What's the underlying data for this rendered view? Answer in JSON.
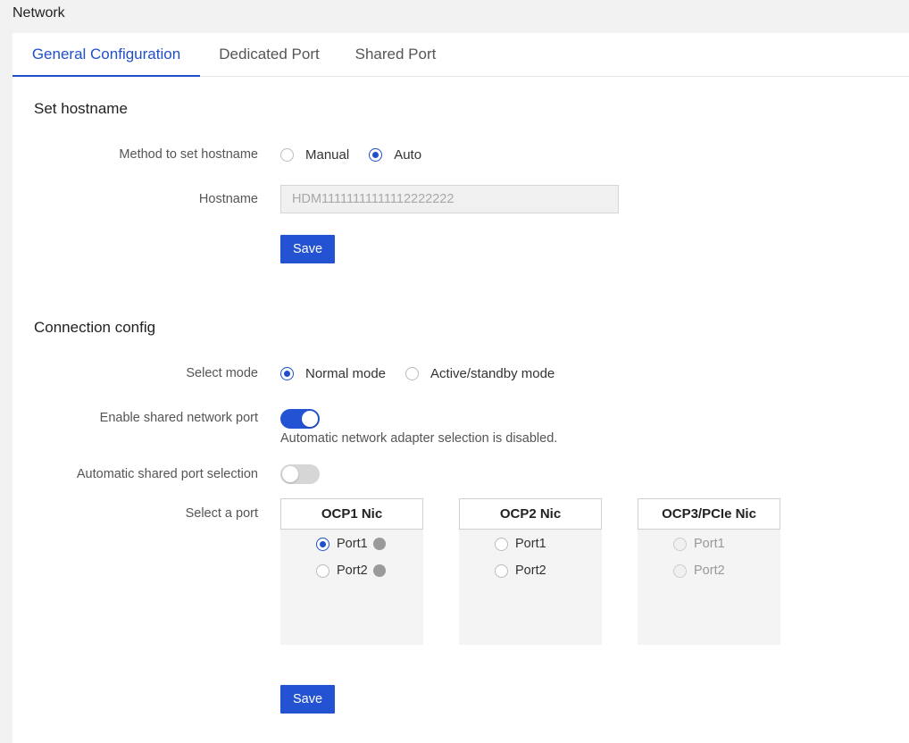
{
  "page": {
    "title": "Network"
  },
  "tabs": [
    {
      "label": "General Configuration",
      "active": true
    },
    {
      "label": "Dedicated Port",
      "active": false
    },
    {
      "label": "Shared Port",
      "active": false
    }
  ],
  "hostname_section": {
    "title": "Set hostname",
    "method_label": "Method to set hostname",
    "method_options": [
      "Manual",
      "Auto"
    ],
    "method_selected": "Auto",
    "hostname_label": "Hostname",
    "hostname_value": "HDM11111111111112222222",
    "save_label": "Save"
  },
  "connection_section": {
    "title": "Connection config",
    "mode_label": "Select mode",
    "mode_options": [
      "Normal mode",
      "Active/standby mode"
    ],
    "mode_selected": "Normal mode",
    "shared_port_label": "Enable shared network port",
    "shared_port_enabled": true,
    "shared_port_hint": "Automatic network adapter selection is disabled.",
    "auto_select_label": "Automatic shared port selection",
    "auto_select_enabled": false,
    "select_port_label": "Select a port",
    "nics": [
      {
        "name": "OCP1 Nic",
        "ports": [
          {
            "label": "Port1",
            "checked": true,
            "disabled": false,
            "status": true
          },
          {
            "label": "Port2",
            "checked": false,
            "disabled": false,
            "status": true
          }
        ]
      },
      {
        "name": "OCP2 Nic",
        "ports": [
          {
            "label": "Port1",
            "checked": false,
            "disabled": false,
            "status": false
          },
          {
            "label": "Port2",
            "checked": false,
            "disabled": false,
            "status": false
          }
        ]
      },
      {
        "name": "OCP3/PCIe Nic",
        "ports": [
          {
            "label": "Port1",
            "checked": false,
            "disabled": true,
            "status": false
          },
          {
            "label": "Port2",
            "checked": false,
            "disabled": true,
            "status": false
          }
        ]
      }
    ],
    "save_label": "Save"
  },
  "colors": {
    "accent": "#2352d3",
    "tab_active": "#1f4fc9",
    "status_dot": "#9a9a9a"
  }
}
